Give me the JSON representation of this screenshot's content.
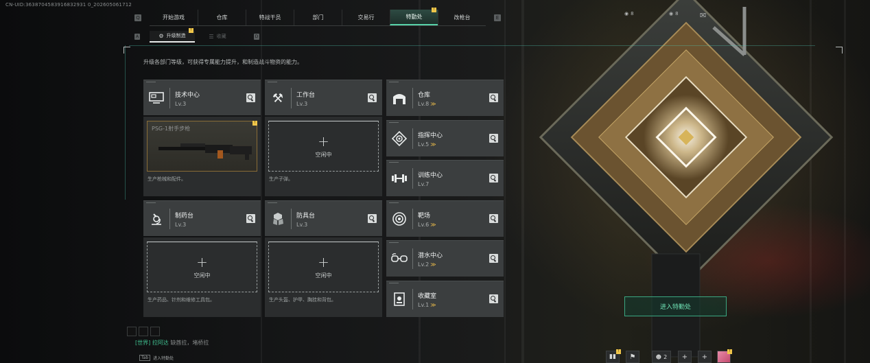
{
  "uid": "CN-UID:3638704583916832931 0_202605061712",
  "nav": {
    "tabs": [
      {
        "label": "开始游戏"
      },
      {
        "label": "仓库"
      },
      {
        "label": "特战干员"
      },
      {
        "label": "部门"
      },
      {
        "label": "交易行"
      },
      {
        "label": "特勤处",
        "badge": "!"
      },
      {
        "label": "改枪台"
      }
    ],
    "left_key": "Q",
    "right_key": "E"
  },
  "subnav": {
    "tabs": [
      {
        "label": "升级制造",
        "badge": "!"
      },
      {
        "label": "收藏"
      }
    ],
    "left_key": "A",
    "right_key": "D"
  },
  "description": "升级各部门等级，可获得专属能力提升，和制造战斗物资的能力。",
  "production": [
    {
      "name": "技术中心",
      "level": "Lv.3",
      "icon": "monitor-icon",
      "slot": {
        "type": "item",
        "item_name": "PSG-1射手步枪",
        "badge": "!"
      },
      "note": "生产枪械和配件。"
    },
    {
      "name": "工作台",
      "level": "Lv.3",
      "icon": "tools-icon",
      "slot": {
        "type": "empty",
        "plus": "+",
        "label": "空闲中"
      },
      "note": "生产子弹。"
    },
    {
      "name": "制药台",
      "level": "Lv.3",
      "icon": "microscope-icon",
      "slot": {
        "type": "empty",
        "plus": "+",
        "label": "空闲中"
      },
      "note": "生产药品、针剂和维修工具包。"
    },
    {
      "name": "防具台",
      "level": "Lv.3",
      "icon": "armor-icon",
      "slot": {
        "type": "empty",
        "plus": "+",
        "label": "空闲中"
      },
      "note": "生产头盔、护甲、胸挂和背包。"
    }
  ],
  "departments": [
    {
      "name": "仓库",
      "level": "Lv.8",
      "upgradable": true,
      "icon": "garage-icon"
    },
    {
      "name": "指挥中心",
      "level": "Lv.5",
      "upgradable": true,
      "icon": "command-icon"
    },
    {
      "name": "训练中心",
      "level": "Lv.7",
      "upgradable": false,
      "icon": "dumbbell-icon"
    },
    {
      "name": "靶场",
      "level": "Lv.6",
      "upgradable": true,
      "icon": "target-icon"
    },
    {
      "name": "潜水中心",
      "level": "Lv.2",
      "upgradable": true,
      "icon": "diving-goggles-icon"
    },
    {
      "name": "收藏室",
      "level": "Lv.1",
      "upgradable": true,
      "icon": "collection-icon"
    }
  ],
  "upgrade_mark": "≫",
  "enter_button": "进入特勤处",
  "top_right": {
    "currency_a": "8",
    "currency_b": "8"
  },
  "chat": {
    "channel": "[世界]",
    "name": "拉阿达",
    "message": "缺酋拉，堵桥拉",
    "enter_label": "进入特勤处",
    "enter_key": "Tab"
  },
  "bottom_right": {
    "friends_count": "2"
  },
  "colors": {
    "accent": "#58d3a9",
    "badge": "#f0c64a",
    "upgrade": "#e6b84a",
    "enter_button": "#3aa882"
  }
}
